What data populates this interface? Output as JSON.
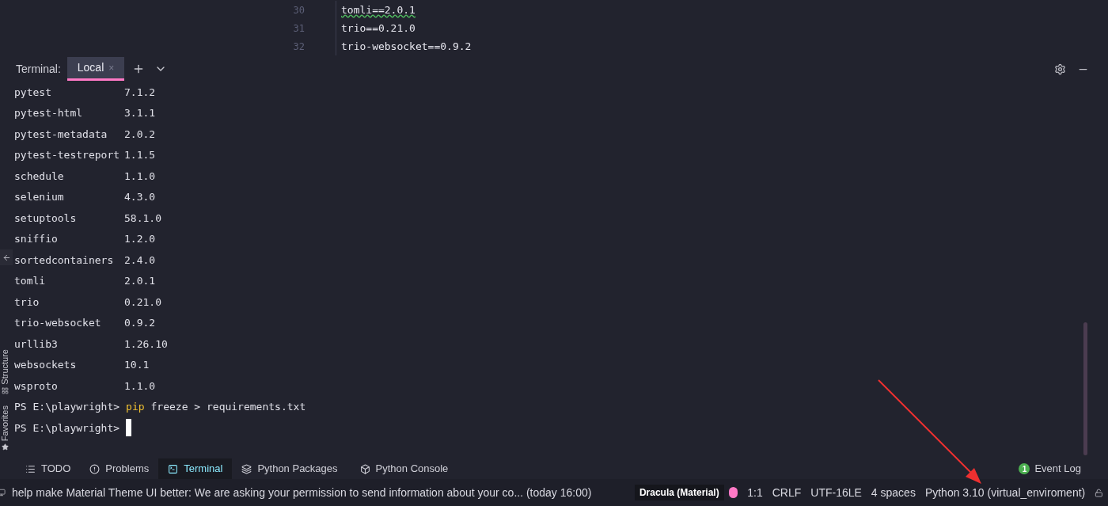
{
  "editor": {
    "lines": [
      {
        "number": "30",
        "text": "tomli==2.0.1",
        "warning": true
      },
      {
        "number": "31",
        "text": "trio==0.21.0",
        "warning": false
      },
      {
        "number": "32",
        "text": "trio-websocket==0.9.2",
        "warning": false
      }
    ]
  },
  "terminal": {
    "label": "Terminal:",
    "tabs": [
      {
        "label": "Local",
        "close": "×",
        "selected": true
      }
    ],
    "packages": [
      {
        "name": "pytest",
        "version": "7.1.2"
      },
      {
        "name": "pytest-html",
        "version": "3.1.1"
      },
      {
        "name": "pytest-metadata",
        "version": "2.0.2"
      },
      {
        "name": "pytest-testreport",
        "version": "1.1.5"
      },
      {
        "name": "schedule",
        "version": "1.1.0"
      },
      {
        "name": "selenium",
        "version": "4.3.0"
      },
      {
        "name": "setuptools",
        "version": "58.1.0"
      },
      {
        "name": "sniffio",
        "version": "1.2.0"
      },
      {
        "name": "sortedcontainers",
        "version": "2.4.0"
      },
      {
        "name": "tomli",
        "version": "2.0.1"
      },
      {
        "name": "trio",
        "version": "0.21.0"
      },
      {
        "name": "trio-websocket",
        "version": "0.9.2"
      },
      {
        "name": "urllib3",
        "version": "1.26.10"
      },
      {
        "name": "websockets",
        "version": "10.1"
      },
      {
        "name": "wsproto",
        "version": "1.1.0"
      }
    ],
    "prompts": [
      {
        "prompt": "PS E:\\playwright>",
        "command": "pip",
        "args": "freeze > requirements.txt",
        "cursor": false
      },
      {
        "prompt": "PS E:\\playwright>",
        "cursor": true
      }
    ]
  },
  "side_tools": [
    {
      "label": "Structure",
      "kind": "structure"
    },
    {
      "label": "Favorites",
      "kind": "favorites"
    }
  ],
  "tool_tabs": [
    {
      "label": "TODO",
      "kind": "todo",
      "selected": false
    },
    {
      "label": "Problems",
      "kind": "problems",
      "selected": false
    },
    {
      "label": "Terminal",
      "kind": "terminal",
      "selected": true
    },
    {
      "label": "Python Packages",
      "kind": "packages",
      "selected": false
    },
    {
      "label": "Python Console",
      "kind": "console",
      "selected": false
    }
  ],
  "event_log": {
    "count": "1",
    "label": "Event Log"
  },
  "status_bar": {
    "message": "help make Material Theme UI better: We are asking your permission to send information about your co... (today 16:00)",
    "theme": "Dracula (Material)",
    "items": [
      "1:1",
      "CRLF",
      "UTF-16LE",
      "4 spaces",
      "Python 3.10 (virtual_enviroment)"
    ]
  }
}
